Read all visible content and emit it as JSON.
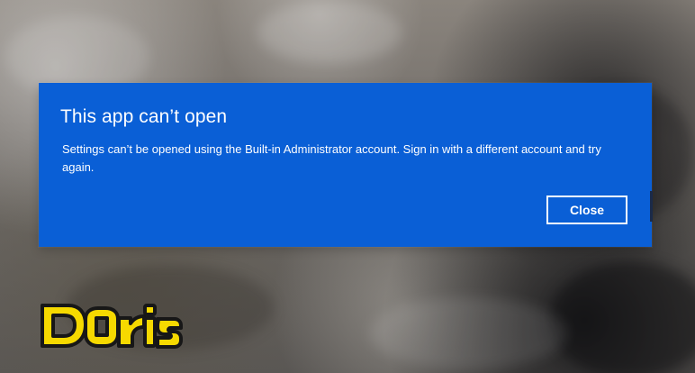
{
  "dialog": {
    "title": "This app can’t open",
    "message": "Settings can’t be opened using the Built-in Administrator account. Sign in with a different account and try again.",
    "close_label": "Close"
  },
  "watermark": {
    "text": "Doris"
  },
  "colors": {
    "dialog_background": "#0a5fd6",
    "dialog_text": "#ffffff",
    "watermark_fill": "#f6d900",
    "watermark_outline": "#171717"
  }
}
